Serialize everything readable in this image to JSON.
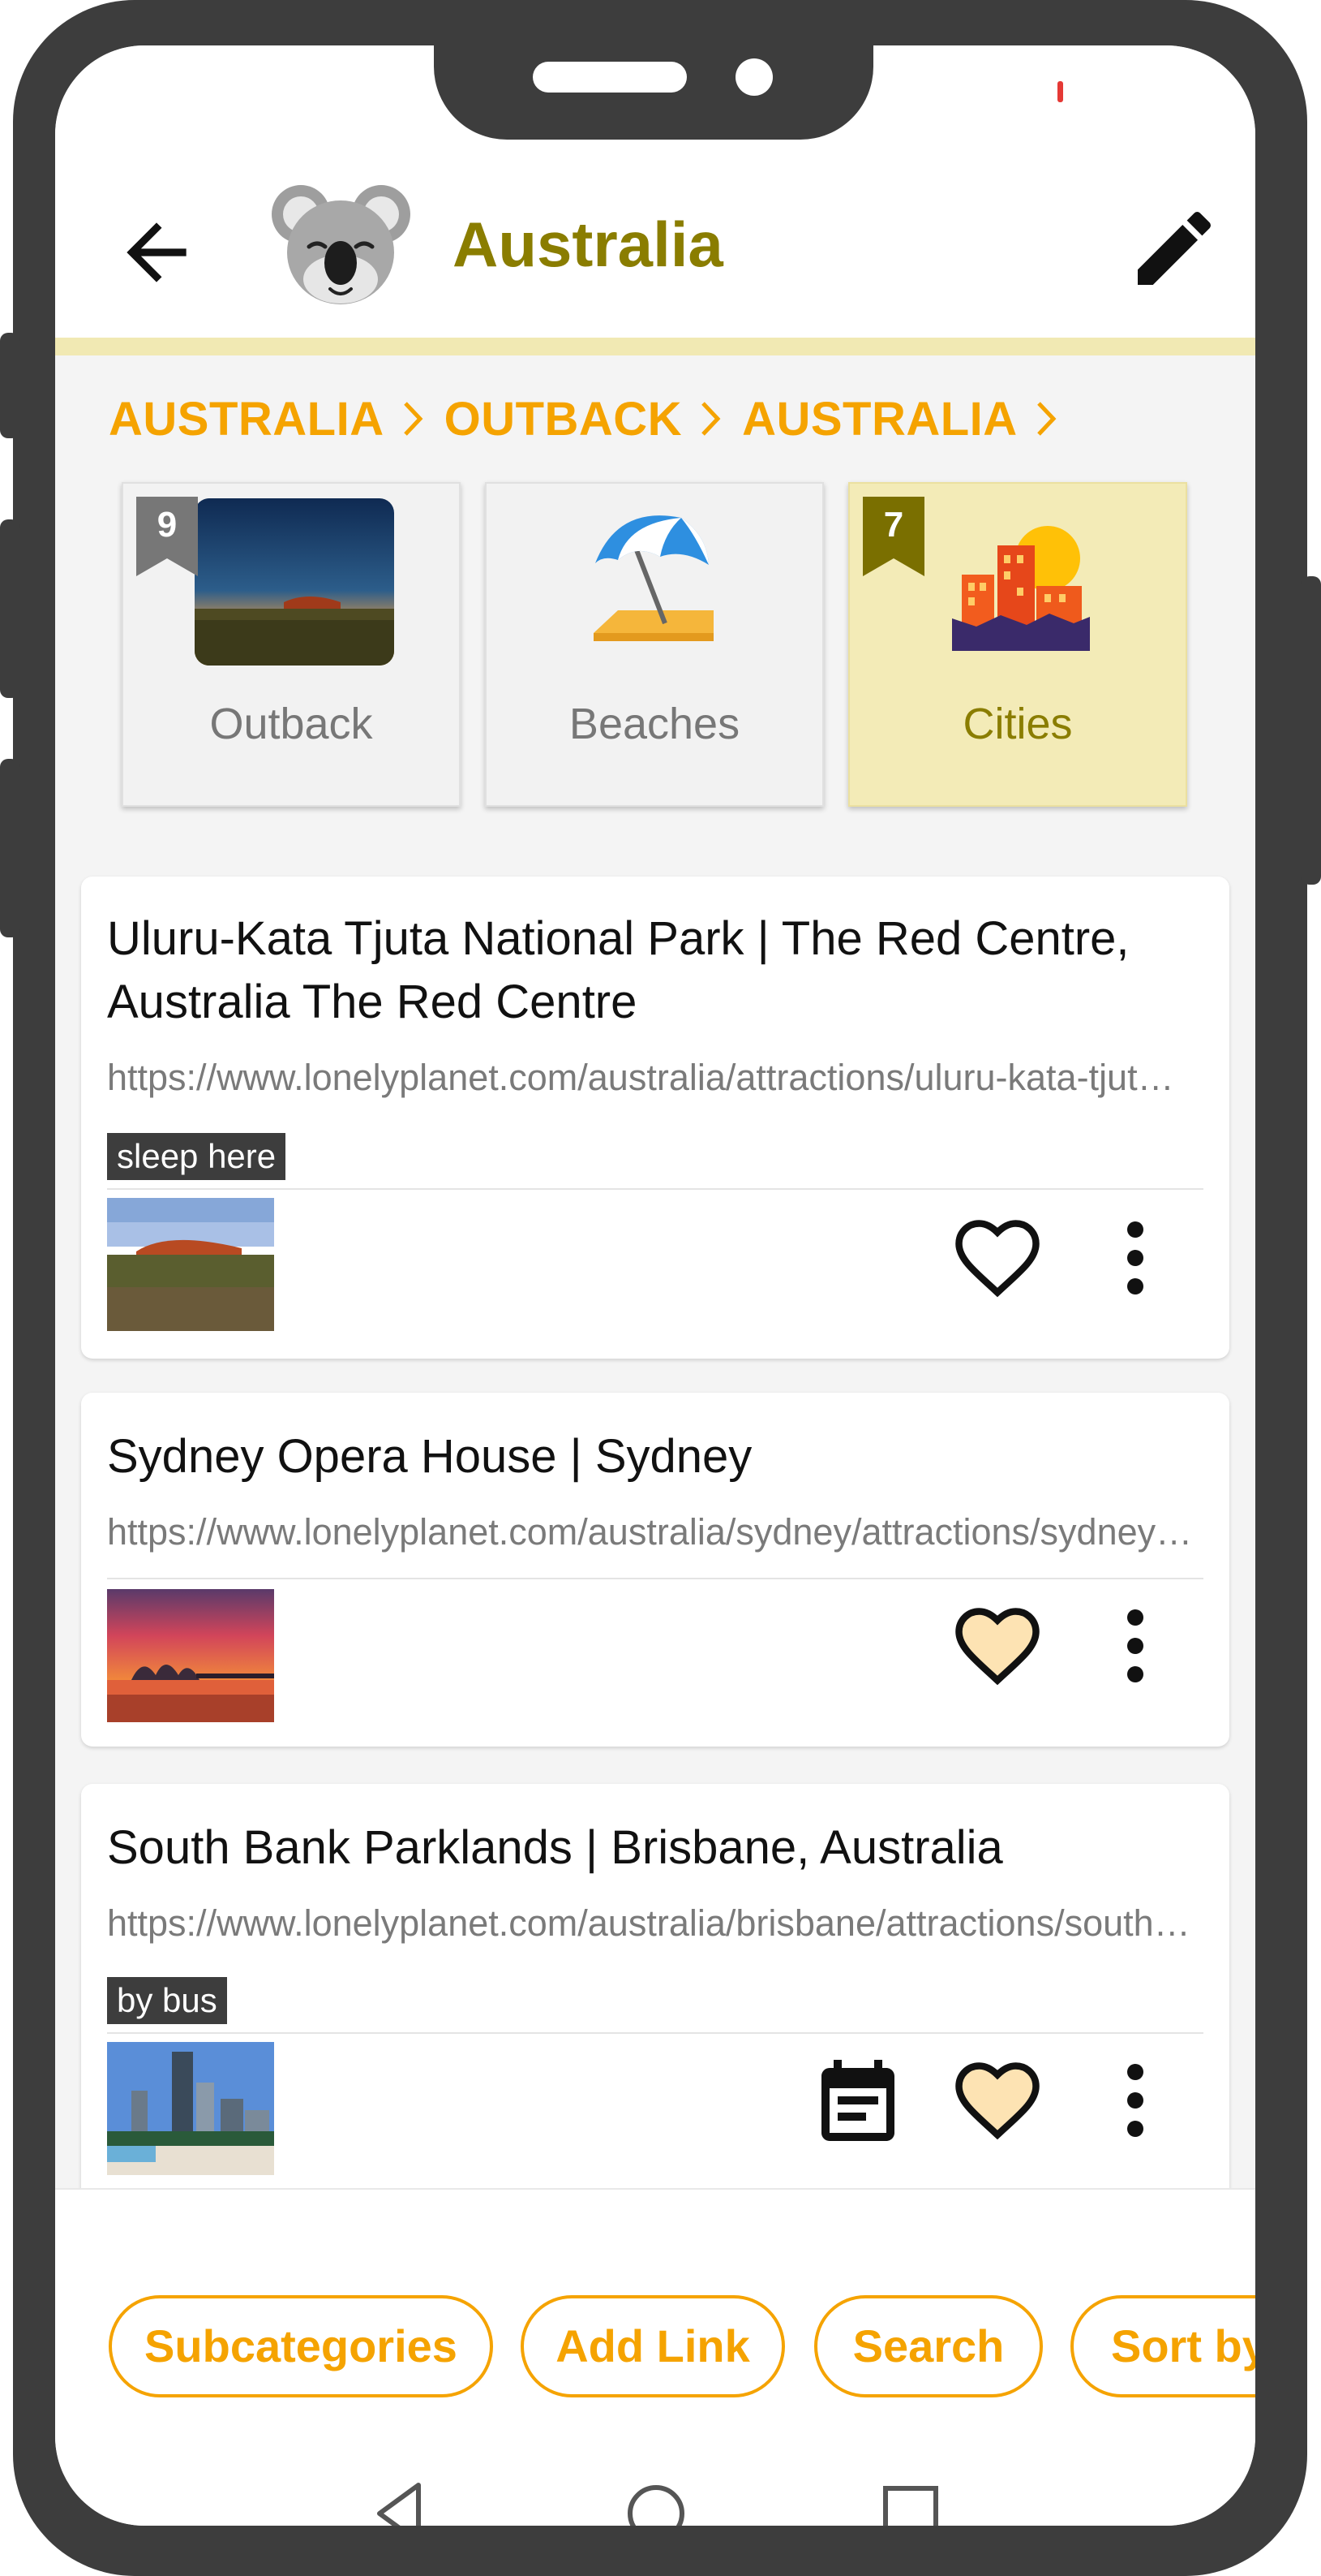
{
  "app_bar": {
    "title": "Australia",
    "back_icon": "arrow-left-icon",
    "logo_icon": "koala-icon",
    "edit_icon": "pencil-icon"
  },
  "breadcrumb": [
    "AUSTRALIA",
    "OUTBACK",
    "AUSTRALIA"
  ],
  "categories": [
    {
      "label": "Outback",
      "count": "9",
      "active": false,
      "image": "uluru-sunset-photo"
    },
    {
      "label": "Beaches",
      "count": "",
      "active": false,
      "image": "beach-umbrella-emoji"
    },
    {
      "label": "Cities",
      "count": "7",
      "active": true,
      "image": "cityscape-sunset-emoji"
    }
  ],
  "links": [
    {
      "title": "Uluru-Kata Tjuta National Park | The Red Centre, Australia The Red Centre",
      "url": "https://www.lonelyplanet.com/australia/attractions/uluru-kata-tjuta-national-park",
      "tag": "sleep here",
      "favorite": false,
      "thumbnail": "uluru-photo"
    },
    {
      "title": "Sydney Opera House | Sydney",
      "url": "https://www.lonelyplanet.com/australia/sydney/attractions/sydney-opera-house",
      "tag": "",
      "favorite": true,
      "thumbnail": "sydney-opera-house-photo"
    },
    {
      "title": "South Bank Parklands | Brisbane, Australia",
      "url": "https://www.lonelyplanet.com/australia/brisbane/attractions/south-bank-parklands",
      "tag": "by bus",
      "favorite": true,
      "has_calendar": true,
      "thumbnail": "brisbane-south-bank-photo"
    }
  ],
  "bottom_actions": [
    "Subcategories",
    "Add Link",
    "Search",
    "Sort by"
  ],
  "colors": {
    "accent": "#f5a300",
    "title": "#8a7d00",
    "active_category": "#f3ebb7",
    "favorite_fill": "#fde3b3"
  }
}
